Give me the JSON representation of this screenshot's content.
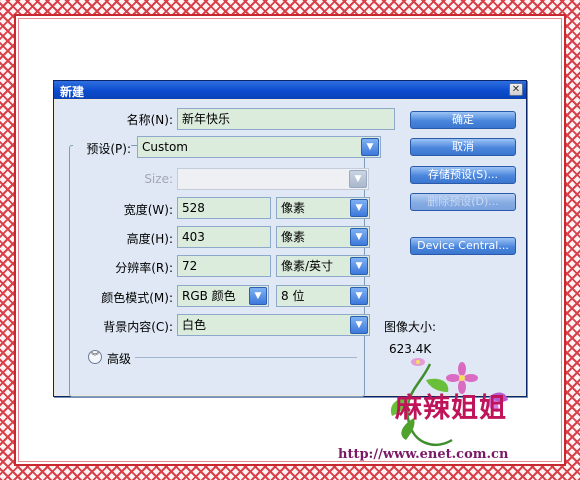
{
  "dialog": {
    "title": "新建",
    "close_glyph": "✕"
  },
  "form": {
    "name_label": "名称(N):",
    "name_value": "新年快乐",
    "preset_label": "预设(P):",
    "preset_value": "Custom",
    "size_label": "Size:",
    "size_value": "",
    "width_label": "宽度(W):",
    "width_value": "528",
    "width_unit": "像素",
    "height_label": "高度(H):",
    "height_value": "403",
    "height_unit": "像素",
    "resolution_label": "分辨率(R):",
    "resolution_value": "72",
    "resolution_unit": "像素/英寸",
    "color_mode_label": "颜色模式(M):",
    "color_mode_value": "RGB 颜色",
    "bit_depth_value": "8 位",
    "background_label": "背景内容(C):",
    "background_value": "白色",
    "advanced_label": "高级",
    "advanced_icon": "double-chevron-down-icon"
  },
  "buttons": {
    "ok": "确定",
    "cancel": "取消",
    "save_preset": "存储预设(S)...",
    "delete_preset": "删除预设(D)...",
    "device_central": "Device Central..."
  },
  "image_size": {
    "title": "图像大小:",
    "value": "623.4K"
  },
  "watermark": {
    "brand_text": "麻辣姐姐",
    "url": "http://www.enet.com.cn"
  },
  "colors": {
    "titlebar": "#0b4bcd",
    "field_bg": "#dbebdc",
    "button": "#4b86dc",
    "frame_red": "#c8282e",
    "brand_pink": "#c0145a"
  }
}
